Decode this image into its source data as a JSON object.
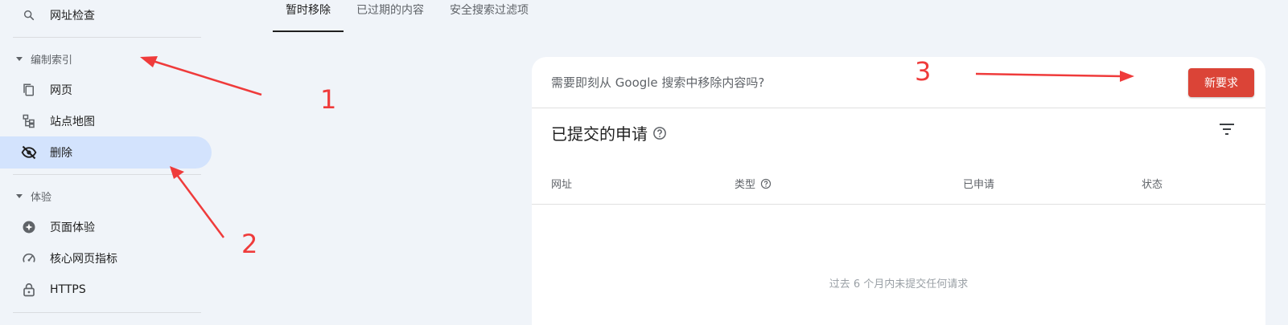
{
  "sidebar": {
    "url_inspection": "网址检查",
    "index_section": "编制索引",
    "pages": "网页",
    "sitemaps": "站点地图",
    "removals": "删除",
    "experience_section": "体验",
    "page_experience": "页面体验",
    "core_web_vitals": "核心网页指标",
    "https": "HTTPS"
  },
  "tabs": [
    "暂时移除",
    "已过期的内容",
    "安全搜索过滤项"
  ],
  "card": {
    "question": "需要即刻从 Google 搜索中移除内容吗?",
    "new_request": "新要求",
    "title": "已提交的申请",
    "columns": [
      "网址",
      "类型",
      "已申请",
      "状态"
    ],
    "empty_message": "过去 6 个月内未提交任何请求"
  },
  "annotations": [
    "1",
    "2",
    "3"
  ],
  "colors": {
    "accent_red": "#db4437",
    "active_bg": "#d3e3fd",
    "annotation": "#ef3b3b"
  }
}
